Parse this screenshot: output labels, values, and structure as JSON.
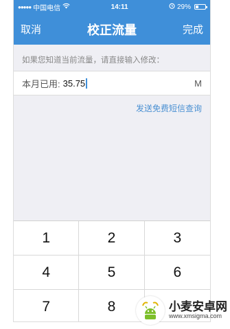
{
  "status_bar": {
    "carrier": "中国电信",
    "time": "14:11",
    "battery": "29%",
    "battery_level": 0.29,
    "icons": [
      "signal-dots-icon",
      "wifi-icon",
      "alarm-icon",
      "battery-icon"
    ]
  },
  "nav": {
    "cancel": "取消",
    "title": "校正流量",
    "done": "完成",
    "color": "#3f8fd9"
  },
  "hint": "如果您知道当前流量，请直接输入修改：",
  "input": {
    "label": "本月已用:",
    "value": "35.75",
    "unit": "M"
  },
  "sms_link": "发送免费短信查询",
  "keypad": [
    "1",
    "2",
    "3",
    "4",
    "5",
    "6",
    "7",
    "8",
    ""
  ],
  "watermark": {
    "name": "小麦安卓网",
    "url": "www.xmsigma.com"
  }
}
